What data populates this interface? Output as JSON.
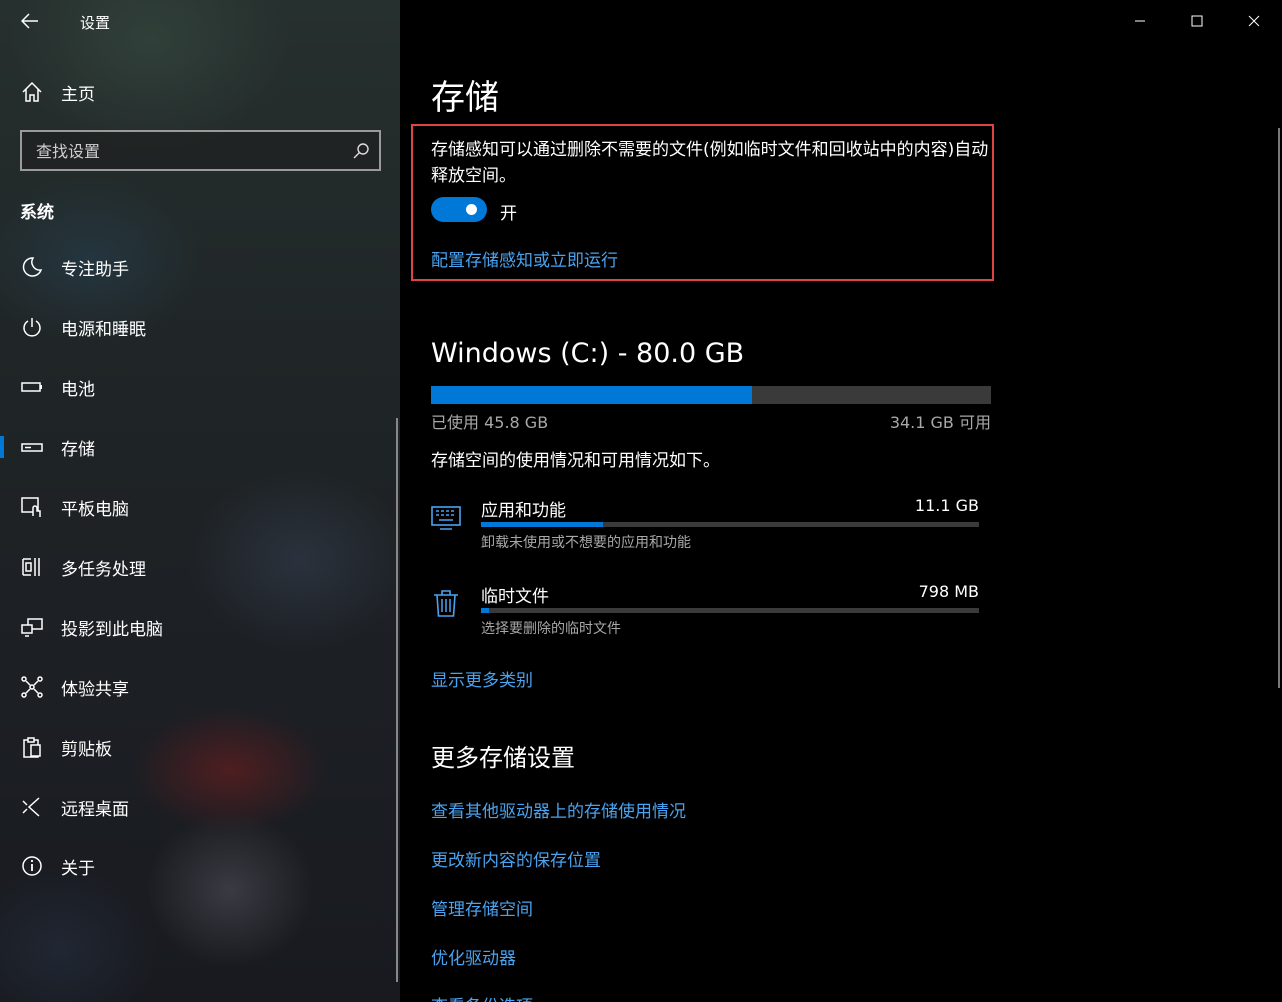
{
  "window": {
    "app_title": "设置",
    "controls": [
      "minimize-icon",
      "maximize-icon",
      "close-icon"
    ]
  },
  "sidebar": {
    "home_label": "主页",
    "search": {
      "placeholder": "查找设置",
      "value": ""
    },
    "section_header": "系统",
    "items": [
      {
        "label": "专注助手",
        "icon": "moon-icon"
      },
      {
        "label": "电源和睡眠",
        "icon": "power-icon"
      },
      {
        "label": "电池",
        "icon": "battery-icon"
      },
      {
        "label": "存储",
        "icon": "storage-icon",
        "selected": true
      },
      {
        "label": "平板电脑",
        "icon": "tablet-icon"
      },
      {
        "label": "多任务处理",
        "icon": "multitask-icon"
      },
      {
        "label": "投影到此电脑",
        "icon": "project-icon"
      },
      {
        "label": "体验共享",
        "icon": "share-icon"
      },
      {
        "label": "剪贴板",
        "icon": "clipboard-icon"
      },
      {
        "label": "远程桌面",
        "icon": "remote-desktop-icon"
      },
      {
        "label": "关于",
        "icon": "info-icon"
      }
    ]
  },
  "main": {
    "title": "存储",
    "storage_sense": {
      "description": "存储感知可以通过删除不需要的文件(例如临时文件和回收站中的内容)自动释放空间。",
      "toggle_state": "开",
      "toggle_on": true,
      "configure_link": "配置存储感知或立即运行"
    },
    "drive": {
      "title": "Windows (C:) - 80.0 GB",
      "used_label": "已使用 45.8 GB",
      "free_label": "34.1 GB 可用",
      "used_fraction": 0.573,
      "usage_desc": "存储空间的使用情况和可用情况如下。",
      "categories": [
        {
          "name": "应用和功能",
          "size": "11.1 GB",
          "desc": "卸载未使用或不想要的应用和功能",
          "fraction": 0.245,
          "icon": "apps-icon"
        },
        {
          "name": "临时文件",
          "size": "798 MB",
          "desc": "选择要删除的临时文件",
          "fraction": 0.017,
          "icon": "trash-icon"
        }
      ],
      "show_more_link": "显示更多类别"
    },
    "more_settings": {
      "title": "更多存储设置",
      "links": [
        "查看其他驱动器上的存储使用情况",
        "更改新内容的保存位置",
        "管理存储空间",
        "优化驱动器",
        "查看备份选项"
      ]
    }
  },
  "colors": {
    "accent": "#0078d7",
    "link": "#4aa3f0",
    "highlight_border": "#e04343"
  }
}
